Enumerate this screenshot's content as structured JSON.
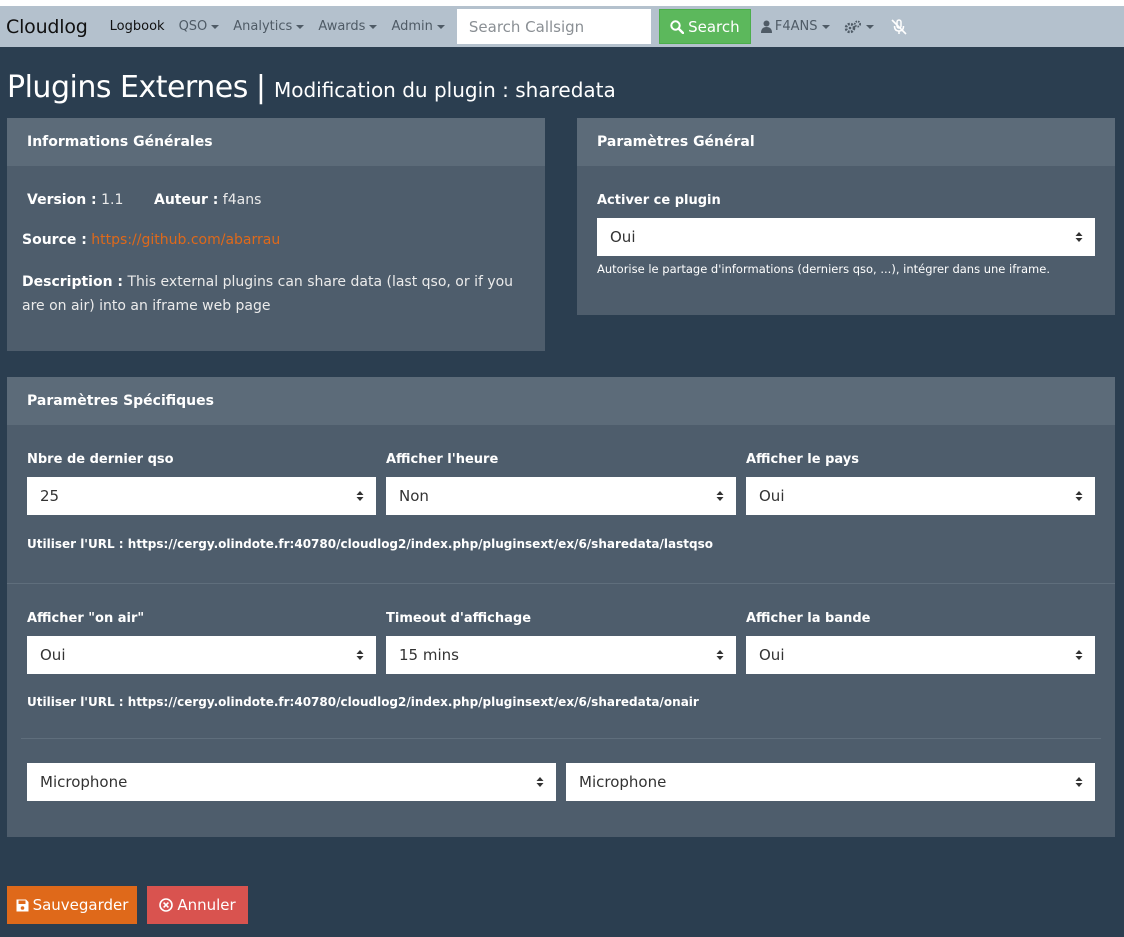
{
  "navbar": {
    "brand": "Cloudlog",
    "items": [
      {
        "label": "Logbook",
        "dropdown": false
      },
      {
        "label": "QSO",
        "dropdown": true
      },
      {
        "label": "Analytics",
        "dropdown": true
      },
      {
        "label": "Awards",
        "dropdown": true
      },
      {
        "label": "Admin",
        "dropdown": true
      }
    ],
    "search_placeholder": "Search Callsign",
    "search_button": "Search",
    "user": "F4ANS"
  },
  "page": {
    "title": "Plugins Externes",
    "separator": "|",
    "subtitle": "Modification du plugin : sharedata"
  },
  "general_info": {
    "header": "Informations Générales",
    "version_label": "Version :",
    "version_value": "1.1",
    "author_label": "Auteur :",
    "author_value": "f4ans",
    "source_label": "Source :",
    "source_value": "https://github.com/abarrau",
    "description_label": "Description :",
    "description_value": "This external plugins can share data (last qso, or if you are on air) into an iframe web page"
  },
  "general_params": {
    "header": "Paramètres Général",
    "enable_label": "Activer ce plugin",
    "enable_value": "Oui",
    "help": "Autorise le partage d'informations (derniers qso, ...), intégrer dans une iframe."
  },
  "specific_params": {
    "header": "Paramètres Spécifiques",
    "row1": {
      "fields": [
        {
          "label": "Nbre de dernier qso",
          "value": "25"
        },
        {
          "label": "Afficher l'heure",
          "value": "Non"
        },
        {
          "label": "Afficher le pays",
          "value": "Oui"
        }
      ],
      "url": "Utiliser l'URL : https://cergy.olindote.fr:40780/cloudlog2/index.php/pluginsext/ex/6/sharedata/lastqso"
    },
    "row2": {
      "fields": [
        {
          "label": "Afficher \"on air\"",
          "value": "Oui"
        },
        {
          "label": "Timeout d'affichage",
          "value": "15 mins"
        },
        {
          "label": "Afficher la bande",
          "value": "Oui"
        }
      ],
      "url": "Utiliser l'URL : https://cergy.olindote.fr:40780/cloudlog2/index.php/pluginsext/ex/6/sharedata/onair"
    },
    "row3": {
      "fields": [
        {
          "value": "Microphone"
        },
        {
          "value": "Microphone"
        }
      ]
    }
  },
  "actions": {
    "save": "Sauvegarder",
    "cancel": "Annuler"
  },
  "colors": {
    "background": "#2b3e50",
    "navbar": "#b4c1cd",
    "card": "#4e5d6c",
    "card_header": "#5c6b79",
    "accent_orange": "#df691a",
    "success": "#5cb85c",
    "danger": "#d9534f"
  },
  "icons": [
    "search-icon",
    "user-icon",
    "gears-icon",
    "microphone-slash-icon",
    "floppy-disk-icon",
    "times-circle-icon",
    "select-arrows-icon"
  ]
}
